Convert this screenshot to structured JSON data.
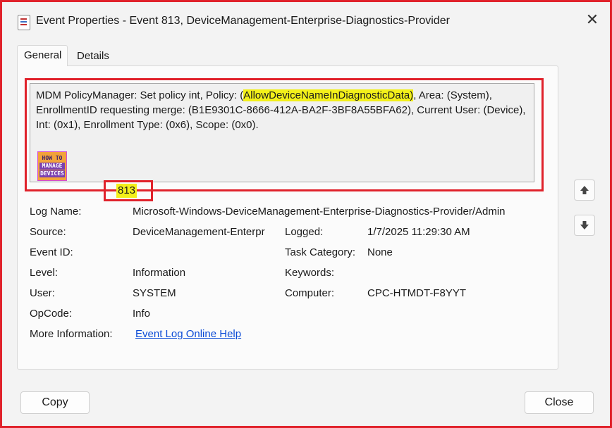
{
  "window": {
    "title": "Event Properties - Event 813, DeviceManagement-Enterprise-Diagnostics-Provider",
    "close_glyph": "✕"
  },
  "tabs": [
    {
      "label": "General",
      "active": true
    },
    {
      "label": "Details",
      "active": false
    }
  ],
  "description": {
    "before": "MDM PolicyManager: Set policy int, Policy: (",
    "highlight": "AllowDeviceNameInDiagnosticData)",
    "after": ", Area: (System), EnrollmentID requesting merge: (B1E9301C-8666-412A-BA2F-3BF8A55BFA62), Current User: (Device), Int: (0x1), Enrollment Type: (0x6), Scope: (0x0)."
  },
  "logo": {
    "line1": "HOW TO",
    "line2": "MANAGE",
    "line3": "DEVICES"
  },
  "fields": {
    "log_name_label": "Log Name:",
    "log_name_value": "Microsoft-Windows-DeviceManagement-Enterprise-Diagnostics-Provider/Admin",
    "source_label": "Source:",
    "source_value": "DeviceManagement-Enterpr",
    "logged_label": "Logged:",
    "logged_value": "1/7/2025 11:29:30 AM",
    "event_id_label": "Event ID:",
    "event_id_value": "813",
    "task_category_label": "Task Category:",
    "task_category_value": "None",
    "level_label": "Level:",
    "level_value": "Information",
    "keywords_label": "Keywords:",
    "keywords_value": "",
    "user_label": "User:",
    "user_value": "SYSTEM",
    "computer_label": "Computer:",
    "computer_value": "CPC-HTMDT-F8YYT",
    "opcode_label": "OpCode:",
    "opcode_value": "Info",
    "more_info_label": "More Information:",
    "more_info_link": "Event Log Online Help"
  },
  "buttons": {
    "copy": "Copy",
    "close": "Close"
  },
  "icons": {
    "up": "arrow-up-icon",
    "down": "arrow-down-icon",
    "title": "event-viewer-icon"
  },
  "colors": {
    "highlight_border": "#e0222b",
    "text_highlight": "#f3f01a",
    "link": "#0b4bd6"
  }
}
